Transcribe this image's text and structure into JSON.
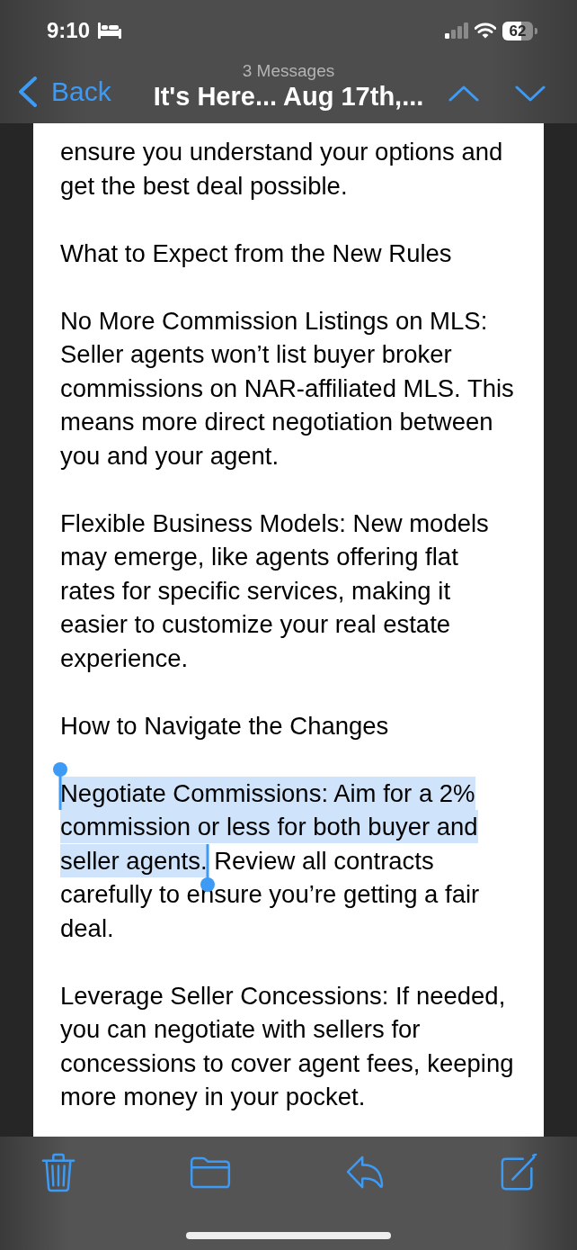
{
  "status_bar": {
    "time": "9:10",
    "battery": "62"
  },
  "nav_bar": {
    "back": "Back",
    "subtitle": "3 Messages",
    "title": "It's Here... Aug 17th,..."
  },
  "message": {
    "paragraphs": [
      {
        "segments": [
          {
            "text": "ensure you understand your options and get the best deal possible.",
            "selected": false
          }
        ]
      },
      {
        "segments": [
          {
            "text": "What to Expect from the New Rules",
            "selected": false
          }
        ]
      },
      {
        "segments": [
          {
            "text": "No More Commission Listings on MLS: Seller agents won’t list buyer broker commissions on NAR-affiliated MLS. This means more direct negotiation between you and your agent.",
            "selected": false
          }
        ]
      },
      {
        "segments": [
          {
            "text": "Flexible Business Models: New models may emerge, like agents offering flat rates for specific services, making it easier to customize your real estate experience.",
            "selected": false
          }
        ]
      },
      {
        "segments": [
          {
            "text": "How to Navigate the Changes",
            "selected": false
          }
        ]
      },
      {
        "segments": [
          {
            "text": "Negotiate Commissions: Aim for a 2% commission or less for both buyer and seller agents.",
            "selected": true
          },
          {
            "text": " Review all contracts carefully to ensure you’re getting a fair deal.",
            "selected": false
          }
        ]
      },
      {
        "segments": [
          {
            "text": "Leverage Seller Concessions: If needed, you can negotiate with sellers for concessions to cover agent fees, keeping more money in your pocket.",
            "selected": false
          }
        ]
      }
    ]
  }
}
